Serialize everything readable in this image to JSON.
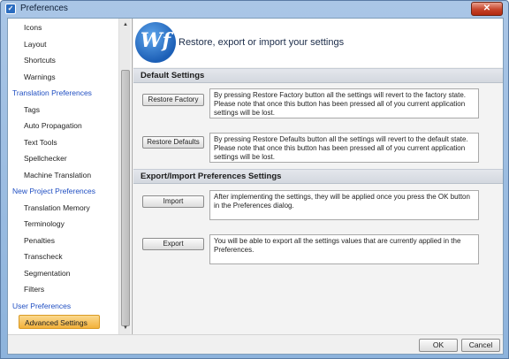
{
  "window": {
    "title": "Preferences",
    "close_glyph": "✕"
  },
  "sidebar": {
    "items": [
      {
        "label": "Icons",
        "kind": "child"
      },
      {
        "label": "Layout",
        "kind": "child"
      },
      {
        "label": "Shortcuts",
        "kind": "child"
      },
      {
        "label": "Warnings",
        "kind": "child"
      },
      {
        "label": "Translation Preferences",
        "kind": "group"
      },
      {
        "label": "Tags",
        "kind": "child"
      },
      {
        "label": "Auto Propagation",
        "kind": "child"
      },
      {
        "label": "Text Tools",
        "kind": "child"
      },
      {
        "label": "Spellchecker",
        "kind": "child"
      },
      {
        "label": "Machine Translation",
        "kind": "child"
      },
      {
        "label": "New Project Preferences",
        "kind": "group"
      },
      {
        "label": "Translation Memory",
        "kind": "child"
      },
      {
        "label": "Terminology",
        "kind": "child"
      },
      {
        "label": "Penalties",
        "kind": "child"
      },
      {
        "label": "Transcheck",
        "kind": "child"
      },
      {
        "label": "Segmentation",
        "kind": "child"
      },
      {
        "label": "Filters",
        "kind": "child"
      },
      {
        "label": "User Preferences",
        "kind": "group"
      },
      {
        "label": "Advanced Settings",
        "kind": "selected"
      }
    ]
  },
  "header": {
    "logo_text": "Wf",
    "title": "Restore, export or import your settings"
  },
  "default_settings": {
    "title": "Default Settings",
    "restore_factory_label": "Restore Factory",
    "restore_factory_desc": "By pressing Restore Factory button all the settings will revert to the factory state. Please note that once this button has been pressed all of you current application settings will be lost.",
    "restore_defaults_label": "Restore Defaults",
    "restore_defaults_desc": "By pressing Restore Defaults button all the settings will revert to the default state. Please note that once this button has been pressed all of you current application settings will be lost."
  },
  "export_import": {
    "title": "Export/Import Preferences Settings",
    "import_label": "Import",
    "import_desc": "After implementing the settings, they will be applied once you press the OK button in the Preferences dialog.",
    "export_label": "Export",
    "export_desc": "You will be able to export all the settings values that are currently applied in the Preferences."
  },
  "footer": {
    "ok_label": "OK",
    "cancel_label": "Cancel"
  }
}
